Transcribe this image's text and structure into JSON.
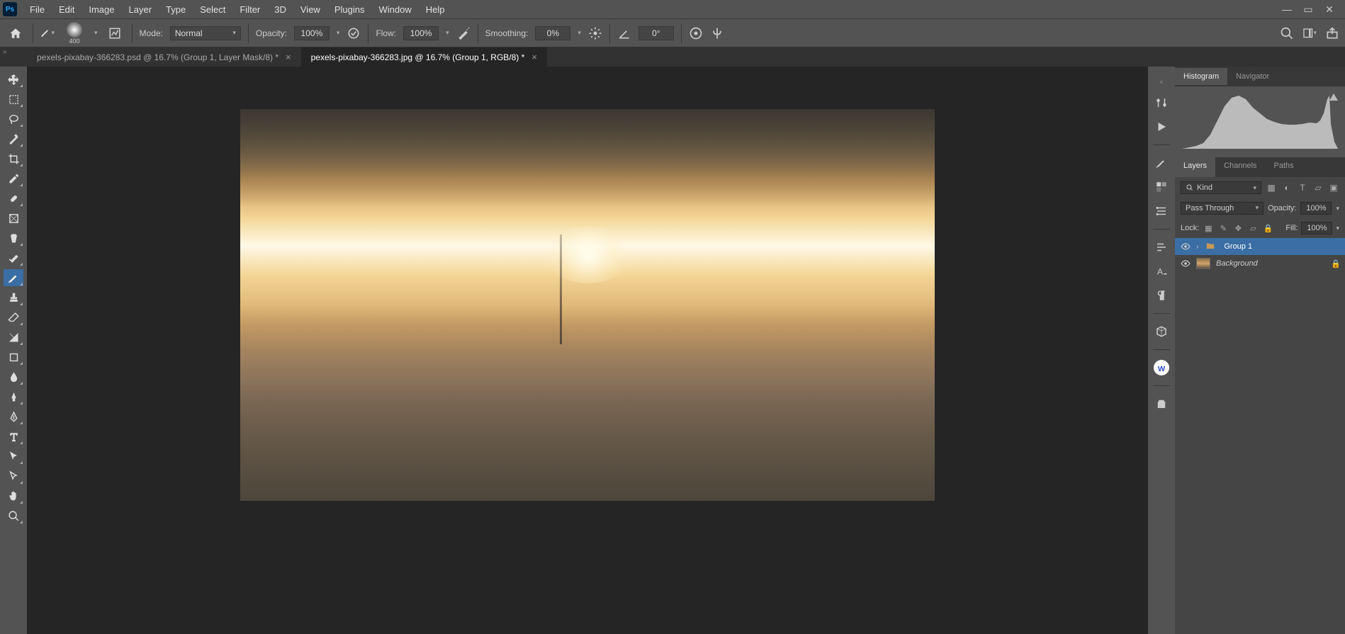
{
  "menubar": [
    "File",
    "Edit",
    "Image",
    "Layer",
    "Type",
    "Select",
    "Filter",
    "3D",
    "View",
    "Plugins",
    "Window",
    "Help"
  ],
  "options": {
    "brush_size": "400",
    "mode_label": "Mode:",
    "mode_value": "Normal",
    "opacity_label": "Opacity:",
    "opacity_value": "100%",
    "flow_label": "Flow:",
    "flow_value": "100%",
    "smoothing_label": "Smoothing:",
    "smoothing_value": "0%",
    "angle_value": "0°"
  },
  "tabs": [
    {
      "label": "pexels-pixabay-366283.psd @ 16.7% (Group 1, Layer Mask/8) *",
      "active": false
    },
    {
      "label": "pexels-pixabay-366283.jpg @ 16.7% (Group 1, RGB/8) *",
      "active": true
    }
  ],
  "panels": {
    "histogram_tab": "Histogram",
    "navigator_tab": "Navigator",
    "layers_tab": "Layers",
    "channels_tab": "Channels",
    "paths_tab": "Paths"
  },
  "layers": {
    "filter_kind": "Kind",
    "blend_mode": "Pass Through",
    "opacity_label": "Opacity:",
    "opacity_value": "100%",
    "lock_label": "Lock:",
    "fill_label": "Fill:",
    "fill_value": "100%",
    "items": [
      {
        "name": "Group 1",
        "type": "group",
        "selected": true
      },
      {
        "name": "Background",
        "type": "bg",
        "locked": true
      }
    ]
  }
}
